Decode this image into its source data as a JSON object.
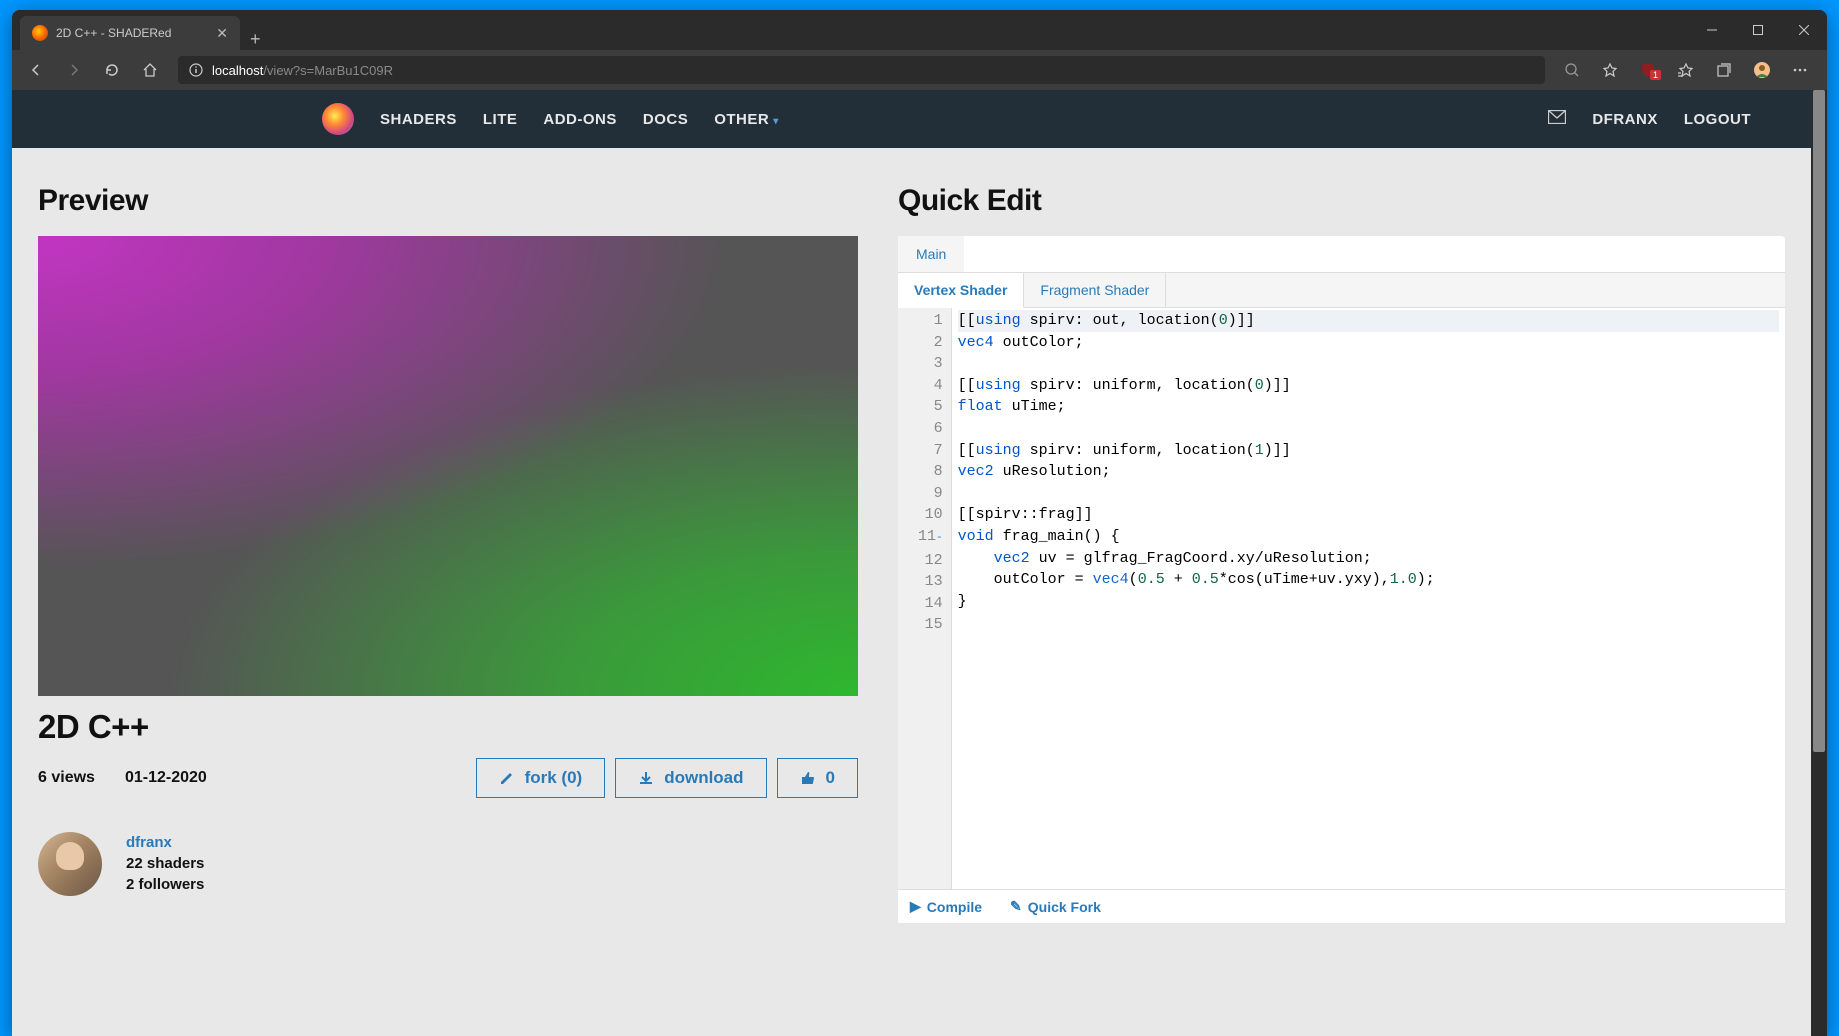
{
  "browser": {
    "tab_title": "2D C++ - SHADERed",
    "url_host": "localhost",
    "url_path": "/view?s=MarBu1C09R",
    "ublock_badge": "1"
  },
  "nav": {
    "items": [
      "SHADERS",
      "LITE",
      "ADD-ONS",
      "DOCS",
      "OTHER"
    ],
    "user": "DFRANX",
    "logout": "LOGOUT"
  },
  "preview": {
    "heading": "Preview",
    "title": "2D C++",
    "views": "6 views",
    "date": "01-12-2020",
    "fork_label": "fork (0)",
    "download_label": "download",
    "like_count": "0"
  },
  "author": {
    "name": "dfranx",
    "shaders": "22 shaders",
    "followers": "2 followers"
  },
  "editor": {
    "heading": "Quick Edit",
    "tabs": [
      "Main"
    ],
    "subtabs": [
      "Vertex Shader",
      "Fragment Shader"
    ],
    "compile": "Compile",
    "quickfork": "Quick Fork",
    "lines": {
      "l1a": "[[",
      "l1b": "using",
      "l1c": " spirv: out, location(",
      "l1d": "0",
      "l1e": ")]]",
      "l2a": "vec4",
      "l2b": " outColor;",
      "l4a": "[[",
      "l4b": "using",
      "l4c": " spirv: uniform, location(",
      "l4d": "0",
      "l4e": ")]]",
      "l5a": "float",
      "l5b": " uTime;",
      "l7a": "[[",
      "l7b": "using",
      "l7c": " spirv: uniform, location(",
      "l7d": "1",
      "l7e": ")]]",
      "l8a": "vec2",
      "l8b": " uResolution;",
      "l10": "[[spirv::frag]]",
      "l11a": "void",
      "l11b": " frag_main() {",
      "l12a": "    ",
      "l12b": "vec2",
      "l12c": " uv = glfrag_FragCoord.xy/uResolution;",
      "l13a": "    outColor = ",
      "l13b": "vec4",
      "l13c": "(",
      "l13d": "0.5",
      "l13e": " + ",
      "l13f": "0.5",
      "l13g": "*cos(uTime+uv.yxy),",
      "l13h": "1.0",
      "l13i": ");",
      "l14": "}"
    },
    "line_numbers": [
      "1",
      "2",
      "3",
      "4",
      "5",
      "6",
      "7",
      "8",
      "9",
      "10",
      "11",
      "12",
      "13",
      "14",
      "15"
    ],
    "fold_marker": "-"
  }
}
